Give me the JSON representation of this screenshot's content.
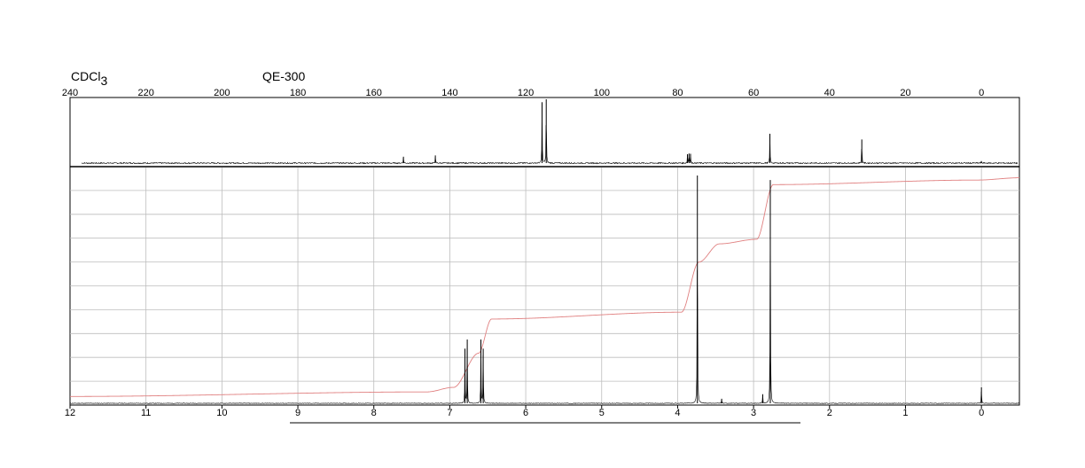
{
  "header": {
    "solvent_prefix": "CDCl",
    "solvent_subscript": "3",
    "instrument": "QE-300"
  },
  "chart_data": [
    {
      "type": "line",
      "nucleus": "13C",
      "xlim": [
        240,
        -10
      ],
      "x_ticks": [
        240,
        220,
        200,
        180,
        160,
        140,
        120,
        100,
        80,
        60,
        40,
        20,
        0
      ],
      "tick_labels": [
        "240",
        "220",
        "200",
        "180",
        "160",
        "140",
        "120",
        "100",
        "80",
        "60",
        "40",
        "20",
        "0"
      ],
      "grid": false,
      "peaks": [
        {
          "ppm": 152.2,
          "rel_height": 0.1
        },
        {
          "ppm": 143.8,
          "rel_height": 0.12
        },
        {
          "ppm": 115.7,
          "rel_height": 0.95
        },
        {
          "ppm": 114.6,
          "rel_height": 1.0
        },
        {
          "ppm": 77.4,
          "rel_height": 0.14
        },
        {
          "ppm": 77.0,
          "rel_height": 0.15
        },
        {
          "ppm": 76.6,
          "rel_height": 0.14
        },
        {
          "ppm": 55.7,
          "rel_height": 0.46
        },
        {
          "ppm": 31.5,
          "rel_height": 0.37
        },
        {
          "ppm": 0.0,
          "rel_height": 0.03
        }
      ]
    },
    {
      "type": "line",
      "nucleus": "1H",
      "xlim": [
        12,
        -0.5
      ],
      "x_ticks": [
        12,
        11,
        10,
        9,
        8,
        7,
        6,
        5,
        4,
        3,
        2,
        1,
        0
      ],
      "tick_labels": [
        "12",
        "11",
        "10",
        "9",
        "8",
        "7",
        "6",
        "5",
        "4",
        "3",
        "2",
        "1",
        "0"
      ],
      "grid": true,
      "peaks": [
        {
          "ppm": 6.8,
          "rel_height": 0.24
        },
        {
          "ppm": 6.77,
          "rel_height": 0.28
        },
        {
          "ppm": 6.59,
          "rel_height": 0.28
        },
        {
          "ppm": 6.56,
          "rel_height": 0.24
        },
        {
          "ppm": 3.74,
          "rel_height": 1.0
        },
        {
          "ppm": 3.42,
          "rel_height": 0.02
        },
        {
          "ppm": 2.88,
          "rel_height": 0.04
        },
        {
          "ppm": 2.78,
          "rel_height": 0.98
        },
        {
          "ppm": 0.0,
          "rel_height": 0.07
        }
      ],
      "integral": [
        {
          "ppm": 12.0,
          "level": 0.03
        },
        {
          "ppm": 7.3,
          "level": 0.05
        },
        {
          "ppm": 6.95,
          "level": 0.07
        },
        {
          "ppm": 6.62,
          "level": 0.22
        },
        {
          "ppm": 6.45,
          "level": 0.37
        },
        {
          "ppm": 3.95,
          "level": 0.4
        },
        {
          "ppm": 3.72,
          "level": 0.62
        },
        {
          "ppm": 3.45,
          "level": 0.7
        },
        {
          "ppm": 2.96,
          "level": 0.72
        },
        {
          "ppm": 2.74,
          "level": 0.96
        },
        {
          "ppm": 0.05,
          "level": 0.98
        },
        {
          "ppm": -0.5,
          "level": 0.99
        }
      ]
    }
  ]
}
